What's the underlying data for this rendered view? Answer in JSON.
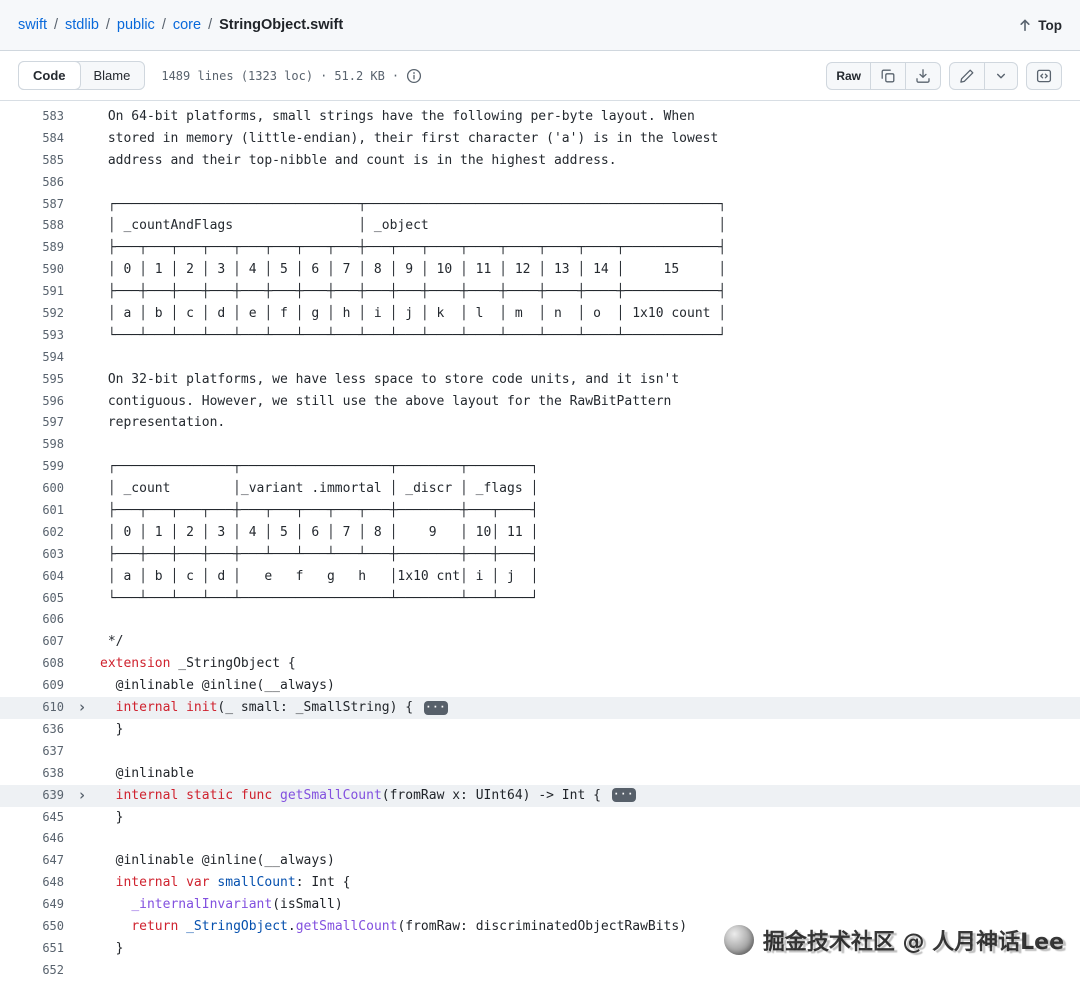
{
  "breadcrumb": {
    "separator": "/",
    "segments": [
      "swift",
      "stdlib",
      "public",
      "core"
    ],
    "file": "StringObject.swift",
    "top_button": "Top"
  },
  "toolbar": {
    "tabs": [
      {
        "label": "Code",
        "active": true
      },
      {
        "label": "Blame",
        "active": false
      }
    ],
    "file_info": "1489 lines (1323 loc)",
    "separator": "·",
    "file_size": "51.2 KB",
    "raw_button": "Raw",
    "icons": [
      "copy-icon",
      "download-icon",
      "pencil-icon",
      "chevron-down-icon",
      "symbols-panel-icon",
      "info-icon",
      "arrow-up-icon"
    ]
  },
  "colors": {
    "link": "#0969da",
    "keyword": "#cf222e",
    "function": "#8250df",
    "constant": "#0550ae",
    "line_number": "#59636e",
    "collapsed_row_bg": "#eef1f4"
  },
  "watermark": {
    "text": "掘金技术社区 @ 人月神话Lee"
  },
  "code": {
    "lines": [
      {
        "n": "583",
        "segs": [
          {
            "c": "cm",
            "t": " On 64-bit platforms, small strings have the following per-byte layout. When"
          }
        ]
      },
      {
        "n": "584",
        "segs": [
          {
            "c": "cm",
            "t": " stored in memory (little-endian), their first character ('a') is in the lowest"
          }
        ]
      },
      {
        "n": "585",
        "segs": [
          {
            "c": "cm",
            "t": " address and their top-nibble and count is in the highest address."
          }
        ]
      },
      {
        "n": "586",
        "segs": []
      },
      {
        "n": "587",
        "segs": [
          {
            "c": "cm",
            "t": " ┌───────────────────────────────┬─────────────────────────────────────────────┐"
          }
        ]
      },
      {
        "n": "588",
        "segs": [
          {
            "c": "cm",
            "t": " │ _countAndFlags                │ _object                                     │"
          }
        ]
      },
      {
        "n": "589",
        "segs": [
          {
            "c": "cm",
            "t": " ├───┬───┬───┬───┬───┬───┬───┬───┼───┬───┬────┬────┬────┬────┬────┬────────────┤"
          }
        ]
      },
      {
        "n": "590",
        "segs": [
          {
            "c": "cm",
            "t": " │ 0 │ 1 │ 2 │ 3 │ 4 │ 5 │ 6 │ 7 │ 8 │ 9 │ 10 │ 11 │ 12 │ 13 │ 14 │     15     │"
          }
        ]
      },
      {
        "n": "591",
        "segs": [
          {
            "c": "cm",
            "t": " ├───┼───┼───┼───┼───┼───┼───┼───┼───┼───┼────┼────┼────┼────┼────┼────────────┤"
          }
        ]
      },
      {
        "n": "592",
        "segs": [
          {
            "c": "cm",
            "t": " │ a │ b │ c │ d │ e │ f │ g │ h │ i │ j │ k  │ l  │ m  │ n  │ o  │ 1x10 count │"
          }
        ]
      },
      {
        "n": "593",
        "segs": [
          {
            "c": "cm",
            "t": " └───┴───┴───┴───┴───┴───┴───┴───┴───┴───┴────┴────┴────┴────┴────┴────────────┘"
          }
        ]
      },
      {
        "n": "594",
        "segs": []
      },
      {
        "n": "595",
        "segs": [
          {
            "c": "cm",
            "t": " On 32-bit platforms, we have less space to store code units, and it isn't"
          }
        ]
      },
      {
        "n": "596",
        "segs": [
          {
            "c": "cm",
            "t": " contiguous. However, we still use the above layout for the RawBitPattern"
          }
        ]
      },
      {
        "n": "597",
        "segs": [
          {
            "c": "cm",
            "t": " representation."
          }
        ]
      },
      {
        "n": "598",
        "segs": []
      },
      {
        "n": "599",
        "segs": [
          {
            "c": "cm",
            "t": " ┌───────────────┬───────────────────┬────────┬────────┐"
          }
        ]
      },
      {
        "n": "600",
        "segs": [
          {
            "c": "cm",
            "t": " │ _count        │_variant .immortal │ _discr │ _flags │"
          }
        ]
      },
      {
        "n": "601",
        "segs": [
          {
            "c": "cm",
            "t": " ├───┬───┬───┬───┼───┬───┬───┬───┬───┼────────┼───┬────┤"
          }
        ]
      },
      {
        "n": "602",
        "segs": [
          {
            "c": "cm",
            "t": " │ 0 │ 1 │ 2 │ 3 │ 4 │ 5 │ 6 │ 7 │ 8 │    9   │ 10│ 11 │"
          }
        ]
      },
      {
        "n": "603",
        "segs": [
          {
            "c": "cm",
            "t": " ├───┼───┼───┼───┼───┴───┴───┴───┴───┼────────┼───┼────┤"
          }
        ]
      },
      {
        "n": "604",
        "segs": [
          {
            "c": "cm",
            "t": " │ a │ b │ c │ d │   e   f   g   h   │1x10 cnt│ i │ j  │"
          }
        ]
      },
      {
        "n": "605",
        "segs": [
          {
            "c": "cm",
            "t": " └───┴───┴───┴───┴───────────────────┴────────┴───┴────┘"
          }
        ]
      },
      {
        "n": "606",
        "segs": []
      },
      {
        "n": "607",
        "segs": [
          {
            "c": "cm",
            "t": " */"
          }
        ]
      },
      {
        "n": "608",
        "segs": [
          {
            "c": "kw",
            "t": "extension"
          },
          {
            "c": "pl",
            "t": " _StringObject {"
          }
        ]
      },
      {
        "n": "609",
        "segs": [
          {
            "c": "pl",
            "t": "  @inlinable @inline(__always)"
          }
        ]
      },
      {
        "n": "610",
        "fold": true,
        "ellipsis": true,
        "segs": [
          {
            "c": "pl",
            "t": "  "
          },
          {
            "c": "kw",
            "t": "internal init"
          },
          {
            "c": "pl",
            "t": "(_ small: _SmallString) { "
          }
        ]
      },
      {
        "n": "636",
        "segs": [
          {
            "c": "pl",
            "t": "  }"
          }
        ]
      },
      {
        "n": "637",
        "segs": []
      },
      {
        "n": "638",
        "segs": [
          {
            "c": "pl",
            "t": "  @inlinable"
          }
        ]
      },
      {
        "n": "639",
        "fold": true,
        "ellipsis": true,
        "segs": [
          {
            "c": "pl",
            "t": "  "
          },
          {
            "c": "kw",
            "t": "internal static func"
          },
          {
            "c": "pl",
            "t": " "
          },
          {
            "c": "fn",
            "t": "getSmallCount"
          },
          {
            "c": "pl",
            "t": "(fromRaw x: UInt64) -> Int { "
          }
        ]
      },
      {
        "n": "645",
        "segs": [
          {
            "c": "pl",
            "t": "  }"
          }
        ]
      },
      {
        "n": "646",
        "segs": []
      },
      {
        "n": "647",
        "segs": [
          {
            "c": "pl",
            "t": "  @inlinable @inline(__always)"
          }
        ]
      },
      {
        "n": "648",
        "segs": [
          {
            "c": "pl",
            "t": "  "
          },
          {
            "c": "kw",
            "t": "internal var"
          },
          {
            "c": "pl",
            "t": " "
          },
          {
            "c": "cn",
            "t": "smallCount"
          },
          {
            "c": "pl",
            "t": ": Int {"
          }
        ]
      },
      {
        "n": "649",
        "segs": [
          {
            "c": "pl",
            "t": "    "
          },
          {
            "c": "fn",
            "t": "_internalInvariant"
          },
          {
            "c": "pl",
            "t": "(isSmall)"
          }
        ]
      },
      {
        "n": "650",
        "segs": [
          {
            "c": "pl",
            "t": "    "
          },
          {
            "c": "kw",
            "t": "return"
          },
          {
            "c": "pl",
            "t": " "
          },
          {
            "c": "cn",
            "t": "_StringObject"
          },
          {
            "c": "pl",
            "t": "."
          },
          {
            "c": "fn",
            "t": "getSmallCount"
          },
          {
            "c": "pl",
            "t": "(fromRaw: discriminatedObjectRawBits)"
          }
        ]
      },
      {
        "n": "651",
        "segs": [
          {
            "c": "pl",
            "t": "  }"
          }
        ]
      },
      {
        "n": "652",
        "segs": []
      }
    ]
  }
}
